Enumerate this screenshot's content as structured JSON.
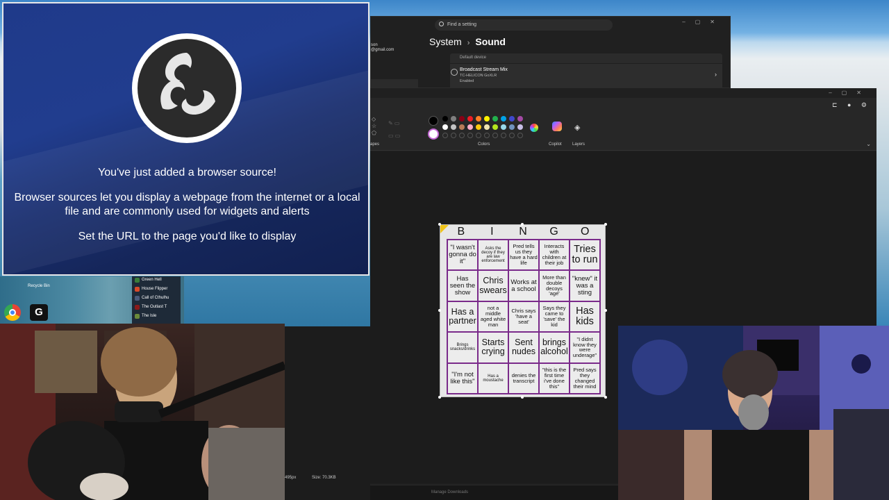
{
  "settings": {
    "search_placeholder": "Find a setting",
    "account_line1": "son",
    "account_line2": "@gmail.com",
    "breadcrumb_parent": "System",
    "breadcrumb_current": "Sound",
    "section_label": "Default device",
    "device_name": "Broadcast Stream Mix",
    "device_model": "TC-HELICON GoXLR",
    "device_status": "Enabled"
  },
  "paint": {
    "shapes_label": "apes",
    "colors_label": "Colors",
    "copilot_label": "Copilot",
    "layers_label": "Layers",
    "status_dims": "495px",
    "status_size": "Size: 70.3KB",
    "downloads_label": "Manage Downloads",
    "palette": [
      "#000000",
      "#7f7f7f",
      "#880015",
      "#ed1c24",
      "#ff7f27",
      "#fff200",
      "#22b14c",
      "#00a2e8",
      "#3f48cc",
      "#a349a4",
      "#ffffff",
      "#c3c3c3",
      "#b97a57",
      "#ffaec9",
      "#ffc90e",
      "#efe4b0",
      "#b5e61d",
      "#99d9ea",
      "#7092be",
      "#c8bfe7"
    ]
  },
  "bingo": {
    "header": [
      "B",
      "I",
      "N",
      "G",
      "O"
    ],
    "cells": [
      {
        "text": "\"I wasn't gonna do it\"",
        "size": "md"
      },
      {
        "text": "Asks the decoy if they are law enforcement",
        "size": "xs"
      },
      {
        "text": "Pred tells us they have a hard life",
        "size": "sm"
      },
      {
        "text": "Interacts with children at their job",
        "size": "sm"
      },
      {
        "text": "Tries to run",
        "size": "xl"
      },
      {
        "text": "Has seen the show",
        "size": "md"
      },
      {
        "text": "Chris swears",
        "size": "lg"
      },
      {
        "text": "Works at a school",
        "size": "md"
      },
      {
        "text": "More than double decoys 'age'",
        "size": "sm"
      },
      {
        "text": "\"knew\" it was a sting",
        "size": "md"
      },
      {
        "text": "Has a partner",
        "size": "lg"
      },
      {
        "text": "not a middle aged white man",
        "size": "sm"
      },
      {
        "text": "Chris says 'have a seat'",
        "size": "sm"
      },
      {
        "text": "Says they came to 'save' the kid",
        "size": "sm"
      },
      {
        "text": "Has kids",
        "size": "xl"
      },
      {
        "text": "Brings snacks/drinks",
        "size": "xs"
      },
      {
        "text": "Starts crying",
        "size": "lg"
      },
      {
        "text": "Sent nudes",
        "size": "lg"
      },
      {
        "text": "brings alcohol",
        "size": "lg"
      },
      {
        "text": "\"I didnt know they were underage\"",
        "size": "sm"
      },
      {
        "text": "\"I'm not like this\"",
        "size": "md"
      },
      {
        "text": "Has a moustache",
        "size": "xs"
      },
      {
        "text": "denies the transcript",
        "size": "sm"
      },
      {
        "text": "\"this is the first time i've done this\"",
        "size": "sm"
      },
      {
        "text": "Pred says they changed their mind",
        "size": "sm"
      }
    ]
  },
  "obs": {
    "line1": "You've just added a browser source!",
    "line2a": "Browser sources let you display a webpage from the internet or a local",
    "line2b": "file and are commonly used for widgets and alerts",
    "line3": "Set the URL to the page you'd like to display"
  },
  "desktop": {
    "recycle_label": "Recycle Bin",
    "games": [
      "Green Hell",
      "House Flipper",
      "Call of Cthulhu",
      "The Outlast T",
      "The Isle"
    ],
    "game_colors": [
      "#3a7d3a",
      "#d84a2a",
      "#4a5a7a",
      "#8a1a1a",
      "#6a8a3a"
    ]
  }
}
